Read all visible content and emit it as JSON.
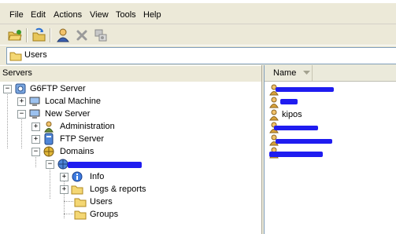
{
  "menu": [
    "File",
    "Edit",
    "Actions",
    "View",
    "Tools",
    "Help"
  ],
  "address": {
    "path": "Users"
  },
  "left_pane": {
    "header": "Servers"
  },
  "tree": {
    "root": "G6FTP Server",
    "local_machine": "Local Machine",
    "new_server": "New Server",
    "administration": "Administration",
    "ftp_server": "FTP Server",
    "domains": "Domains",
    "info": "Info",
    "logs": "Logs & reports",
    "users": "Users",
    "groups": "Groups"
  },
  "right_pane": {
    "column_name": "Name",
    "users": [
      {
        "label": "",
        "redacted": true
      },
      {
        "label": "",
        "redacted": true
      },
      {
        "label": "kipos",
        "redacted": false
      },
      {
        "label": "",
        "redacted": true
      },
      {
        "label": "",
        "redacted": true
      },
      {
        "label": "",
        "redacted": true
      }
    ]
  },
  "colors": {
    "redaction": "#1f1cf0",
    "selection": "#316ac5"
  }
}
